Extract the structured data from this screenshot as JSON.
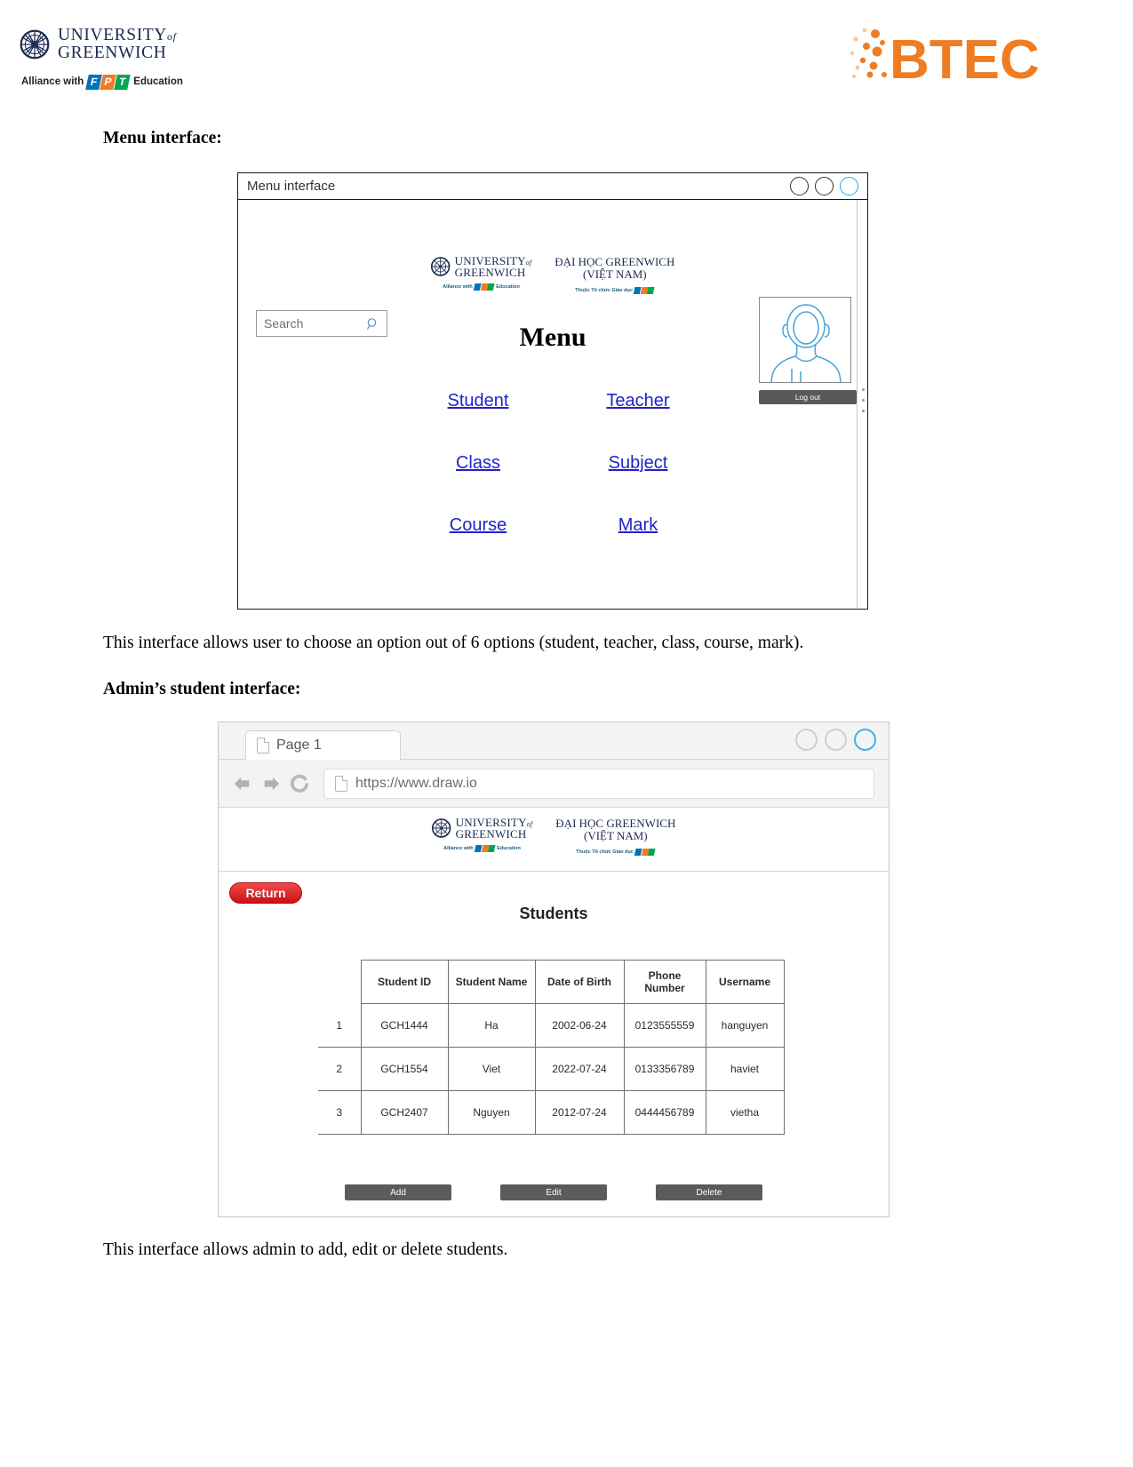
{
  "header": {
    "university_logo": {
      "line1": "UNIVERSITY",
      "of": "of",
      "line2": "GREENWICH",
      "alliance_prefix": "Alliance with",
      "alliance_suffix": "Education",
      "fpt_letters": [
        "F",
        "P",
        "T"
      ]
    },
    "btec_logo_alt": "BTEC",
    "btec_color": "#f07c22"
  },
  "sections": {
    "menu_heading": "Menu interface:",
    "menu_caption": "This interface allows user to choose an option out of 6 options (student, teacher, class, course, mark).",
    "student_heading": "Admin’s student interface:",
    "student_caption": "This interface allows admin to add, edit or delete students."
  },
  "menu_mockup": {
    "window_title": "Menu interface",
    "logos": {
      "uog_line1": "UNIVERSITY",
      "uog_of": "of",
      "uog_line2": "GREENWICH",
      "uog_tagline_prefix": "Alliance with",
      "uog_tagline_suffix": "Education",
      "vn_line1": "ĐẠI HỌC GREENWICH",
      "vn_line2": "(VIỆT NAM)",
      "vn_tagline": "Thuộc Tổ chức Giáo dục"
    },
    "search": {
      "placeholder": "Search",
      "value": ""
    },
    "title": "Menu",
    "links": [
      {
        "label": "Student",
        "color": "#2222cc"
      },
      {
        "label": "Teacher",
        "color": "#2222cc"
      },
      {
        "label": "Class",
        "color": "#2222cc"
      },
      {
        "label": "Subject",
        "color": "#2222cc"
      },
      {
        "label": "Course",
        "color": "#2222cc"
      },
      {
        "label": "Mark",
        "color": "#2222cc"
      }
    ],
    "logout_label": "Log out",
    "avatar_alt": "user-avatar-placeholder"
  },
  "browser_mockup": {
    "tab_label": "Page 1",
    "url": "https://www.draw.io",
    "return_label": "Return",
    "page_title": "Students",
    "table": {
      "columns": [
        "Student ID",
        "Student Name",
        "Date of Birth",
        "Phone Number",
        "Username"
      ],
      "rows": [
        {
          "index": "1",
          "student_id": "GCH1444",
          "student_name": "Ha",
          "dob": "2002-06-24",
          "phone": "0123555559",
          "username": "hanguyen"
        },
        {
          "index": "2",
          "student_id": "GCH1554",
          "student_name": "Viet",
          "dob": "2022-07-24",
          "phone": "0133356789",
          "username": "haviet"
        },
        {
          "index": "3",
          "student_id": "GCH2407",
          "student_name": "Nguyen",
          "dob": "2012-07-24",
          "phone": "0444456789",
          "username": "vietha"
        }
      ]
    },
    "actions": [
      {
        "label": "Add"
      },
      {
        "label": "Edit"
      },
      {
        "label": "Delete"
      }
    ]
  }
}
